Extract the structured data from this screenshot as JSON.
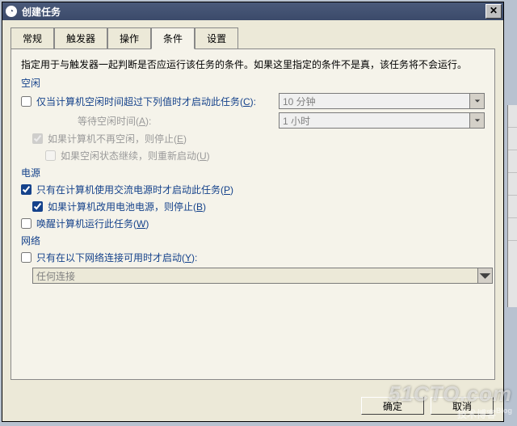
{
  "title": "创建任务",
  "tabs": [
    "常规",
    "触发器",
    "操作",
    "条件",
    "设置"
  ],
  "active_tab": "条件",
  "description": "指定用于与触发器一起判断是否应运行该任务的条件。如果这里指定的条件不是真，该任务将不会运行。",
  "sections": {
    "idle": {
      "label": "空闲",
      "start_if_idle": {
        "text": "仅当计算机空闲时间超过下列值时才启动此任务(",
        "hotkey": "C",
        "suffix": "):"
      },
      "idle_duration": "10 分钟",
      "wait_label": {
        "text": "等待空闲时间(",
        "hotkey": "A",
        "suffix": "):"
      },
      "wait_duration": "1 小时",
      "stop_if_not_idle": {
        "text": "如果计算机不再空闲，则停止(",
        "hotkey": "E",
        "suffix": ")"
      },
      "restart_if_idle": {
        "text": "如果空闲状态继续，则重新启动(",
        "hotkey": "U",
        "suffix": ")"
      }
    },
    "power": {
      "label": "电源",
      "on_ac_only": {
        "text": "只有在计算机使用交流电源时才启动此任务(",
        "hotkey": "P",
        "suffix": ")"
      },
      "stop_on_battery": {
        "text": "如果计算机改用电池电源，则停止(",
        "hotkey": "B",
        "suffix": ")"
      },
      "wake": {
        "text": "唤醒计算机运行此任务(",
        "hotkey": "W",
        "suffix": ")"
      }
    },
    "network": {
      "label": "网络",
      "only_if_network": {
        "text": "只有在以下网络连接可用时才启动(",
        "hotkey": "Y",
        "suffix": "):"
      },
      "connection": "任何连接"
    }
  },
  "buttons": {
    "ok": "确定",
    "cancel": "取消"
  },
  "watermark": {
    "line1": "51CTO.com",
    "line2": "技术博客",
    "sup": "Blog"
  }
}
